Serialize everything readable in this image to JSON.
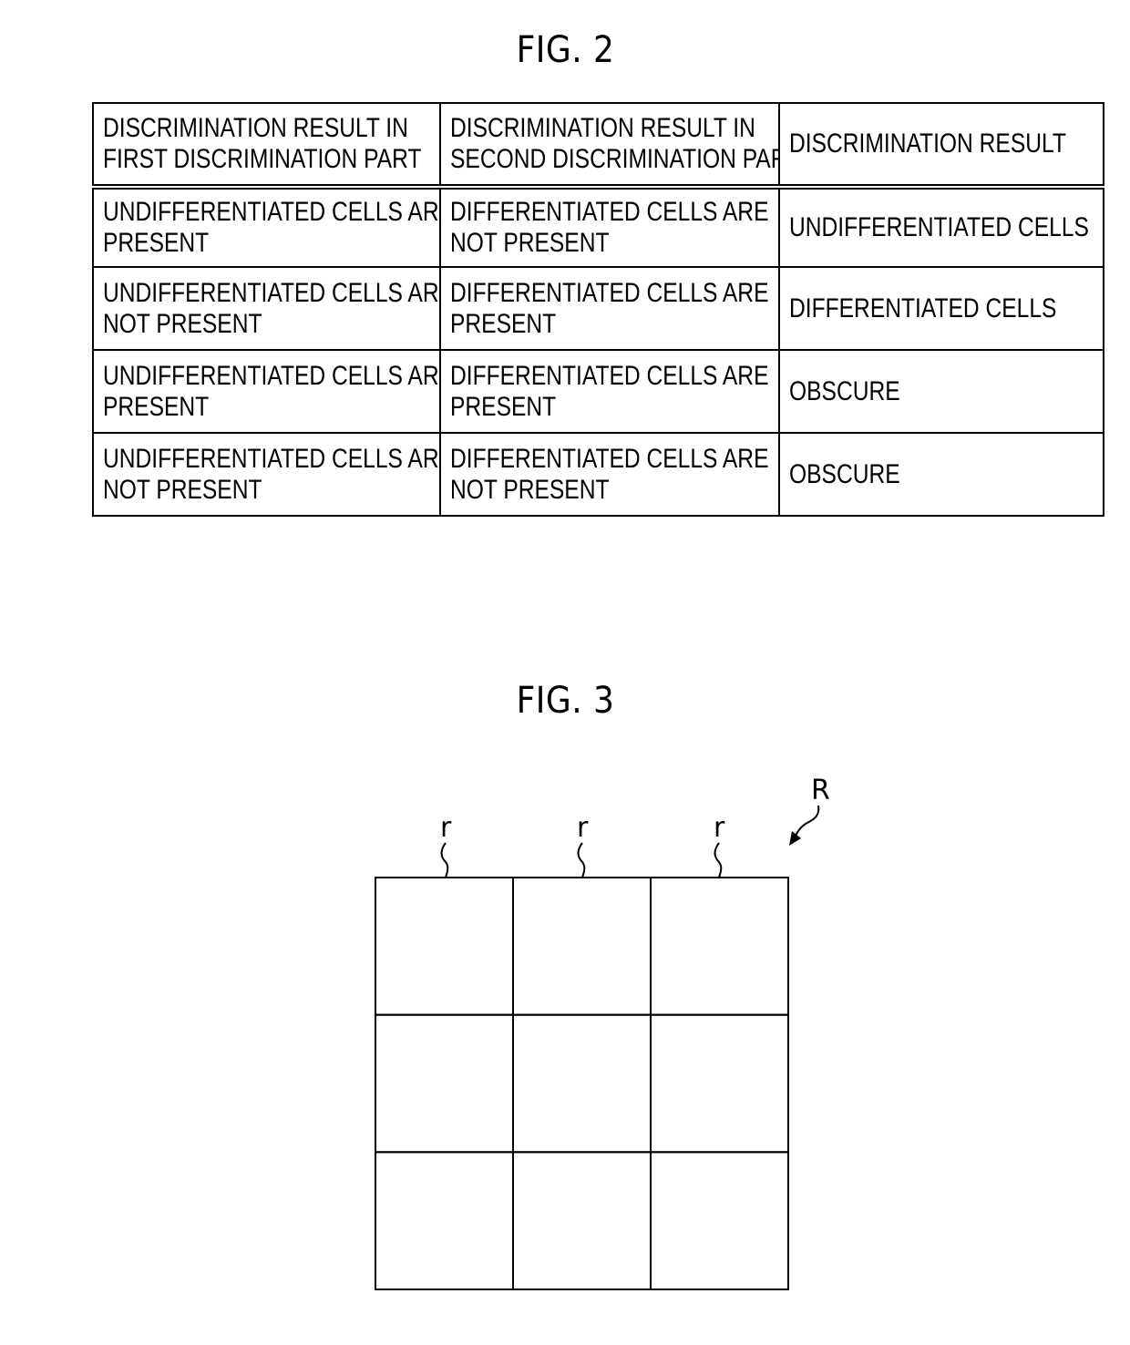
{
  "figure2": {
    "title": "FIG. 2",
    "table": {
      "headers": [
        [
          "DISCRIMINATION RESULT IN",
          "FIRST DISCRIMINATION PART"
        ],
        [
          "DISCRIMINATION RESULT IN",
          "SECOND DISCRIMINATION PART"
        ],
        [
          "DISCRIMINATION RESULT"
        ]
      ],
      "rows": [
        {
          "first_part": [
            "UNDIFFERENTIATED CELLS ARE",
            "PRESENT"
          ],
          "second_part": [
            "DIFFERENTIATED CELLS ARE",
            "NOT PRESENT"
          ],
          "result": "UNDIFFERENTIATED CELLS"
        },
        {
          "first_part": [
            "UNDIFFERENTIATED CELLS ARE",
            "NOT PRESENT"
          ],
          "second_part": [
            "DIFFERENTIATED CELLS ARE",
            "PRESENT"
          ],
          "result": "DIFFERENTIATED CELLS"
        },
        {
          "first_part": [
            "UNDIFFERENTIATED CELLS ARE",
            "PRESENT"
          ],
          "second_part": [
            "DIFFERENTIATED CELLS ARE",
            "PRESENT"
          ],
          "result": "OBSCURE"
        },
        {
          "first_part": [
            "UNDIFFERENTIATED CELLS ARE",
            "NOT PRESENT"
          ],
          "second_part": [
            "DIFFERENTIATED CELLS ARE",
            "NOT PRESENT"
          ],
          "result": "OBSCURE"
        }
      ]
    }
  },
  "figure3": {
    "title": "FIG. 3",
    "region_label": "R",
    "subregion_label": "r",
    "grid": {
      "rows": 3,
      "cols": 3
    },
    "labeled_columns": [
      0,
      1,
      2
    ]
  }
}
